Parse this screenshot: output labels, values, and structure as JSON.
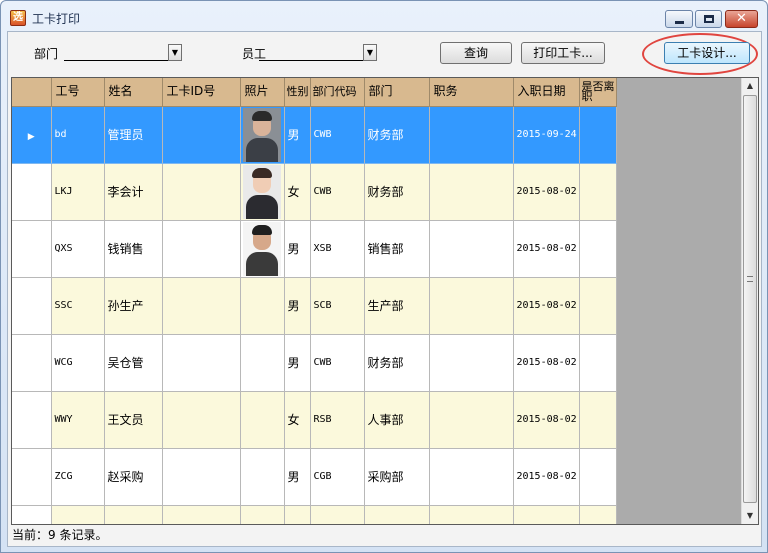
{
  "window": {
    "title": "工卡打印",
    "app_icon_glyph": "选"
  },
  "filters": {
    "dept_label": "部门",
    "dept_value": "",
    "employee_label": "员工",
    "employee_value": ""
  },
  "toolbar": {
    "query_label": "查询",
    "print_label": "打印工卡...",
    "design_label": "工卡设计..."
  },
  "grid": {
    "columns": {
      "id": "工号",
      "name": "姓名",
      "card": "工卡ID号",
      "photo": "照片",
      "gender": "性别",
      "deptcode": "部门代码",
      "dept": "部门",
      "position": "职务",
      "hire": "入职日期",
      "resigned": "是否离职"
    },
    "rows": [
      {
        "id": "bd",
        "name": "管理员",
        "card": "",
        "gender": "男",
        "deptcode": "CWB",
        "dept": "财务部",
        "position": "",
        "hire": "2015-09-24",
        "resigned": "",
        "photo": "man-glasses"
      },
      {
        "id": "LKJ",
        "name": "李会计",
        "card": "",
        "gender": "女",
        "deptcode": "CWB",
        "dept": "财务部",
        "position": "",
        "hire": "2015-08-02",
        "resigned": "",
        "photo": "woman"
      },
      {
        "id": "QXS",
        "name": "钱销售",
        "card": "",
        "gender": "男",
        "deptcode": "XSB",
        "dept": "销售部",
        "position": "",
        "hire": "2015-08-02",
        "resigned": "",
        "photo": "man"
      },
      {
        "id": "SSC",
        "name": "孙生产",
        "card": "",
        "gender": "男",
        "deptcode": "SCB",
        "dept": "生产部",
        "position": "",
        "hire": "2015-08-02",
        "resigned": "",
        "photo": ""
      },
      {
        "id": "WCG",
        "name": "吴仓管",
        "card": "",
        "gender": "男",
        "deptcode": "CWB",
        "dept": "财务部",
        "position": "",
        "hire": "2015-08-02",
        "resigned": "",
        "photo": ""
      },
      {
        "id": "WWY",
        "name": "王文员",
        "card": "",
        "gender": "女",
        "deptcode": "RSB",
        "dept": "人事部",
        "position": "",
        "hire": "2015-08-02",
        "resigned": "",
        "photo": ""
      },
      {
        "id": "ZCG",
        "name": "赵采购",
        "card": "",
        "gender": "男",
        "deptcode": "CGB",
        "dept": "采购部",
        "position": "",
        "hire": "2015-08-02",
        "resigned": "",
        "photo": ""
      },
      {
        "id": "",
        "name": "",
        "card": "",
        "gender": "",
        "deptcode": "",
        "dept": "",
        "position": "",
        "hire": "",
        "resigned": "",
        "photo": ""
      }
    ]
  },
  "status": {
    "text": "当前：9 条记录。"
  },
  "icons": {
    "row_pointer": "▶",
    "dropdown": "▼",
    "scroll_up": "▲",
    "scroll_down": "▼",
    "close": "✕"
  },
  "colors": {
    "header_bg": "#d8b98f",
    "selected_row": "#3399ff",
    "alt_row": "#fbf9dc",
    "highlight_ring": "#e0453f"
  }
}
